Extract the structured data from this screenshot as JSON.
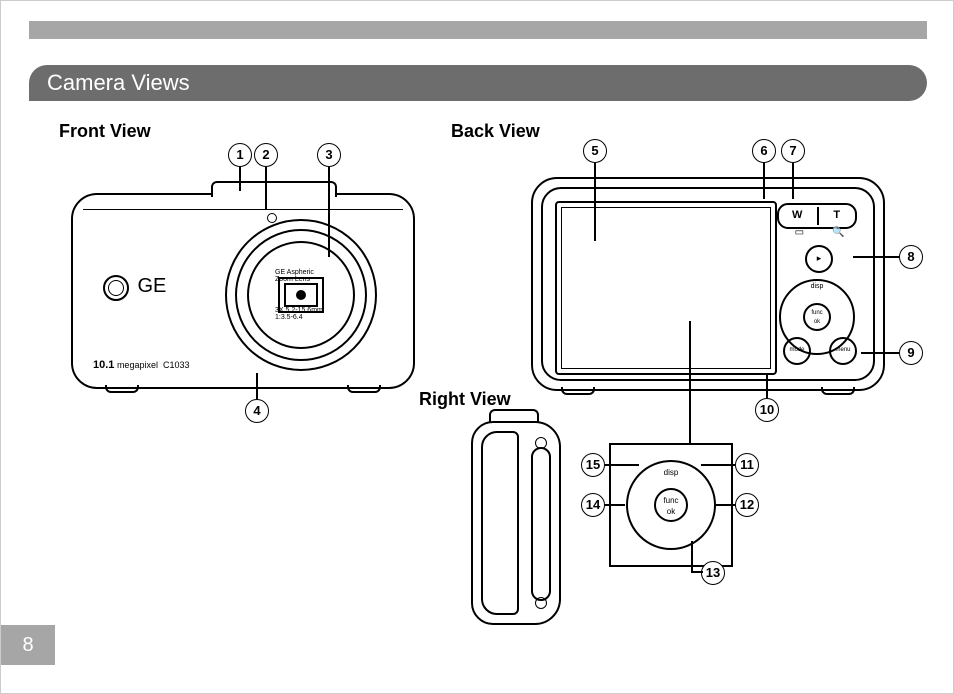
{
  "page": {
    "number": "8"
  },
  "section": {
    "title": "Camera Views"
  },
  "views": {
    "front": {
      "label": "Front View"
    },
    "back": {
      "label": "Back View"
    },
    "right": {
      "label": "Right View"
    }
  },
  "front_camera": {
    "brand": "GE",
    "megapixel_value": "10.1",
    "megapixel_label": "megapixel",
    "model": "C1033",
    "lens_text_top": "GE Aspheric Zoom Lens",
    "lens_text_bottom": "3X 5.2-15.6mm 1:3.5-6.4"
  },
  "back_camera": {
    "zoom_wide": "W",
    "zoom_tele": "T",
    "zoom_wide_sym": "▭",
    "zoom_tele_sym": "🔍",
    "play_icon": "▸",
    "mode_label": "mode",
    "menu_label": "menu",
    "dpad_center_top": "func",
    "dpad_center_bottom": "ok",
    "dpad_top_label": "disp"
  },
  "detail_dpad": {
    "center_top": "func",
    "center_bottom": "ok",
    "top_label": "disp"
  },
  "callouts": {
    "c1": "1",
    "c2": "2",
    "c3": "3",
    "c4": "4",
    "c5": "5",
    "c6": "6",
    "c7": "7",
    "c8": "8",
    "c9": "9",
    "c10": "10",
    "c11": "11",
    "c12": "12",
    "c13": "13",
    "c14": "14",
    "c15": "15"
  }
}
